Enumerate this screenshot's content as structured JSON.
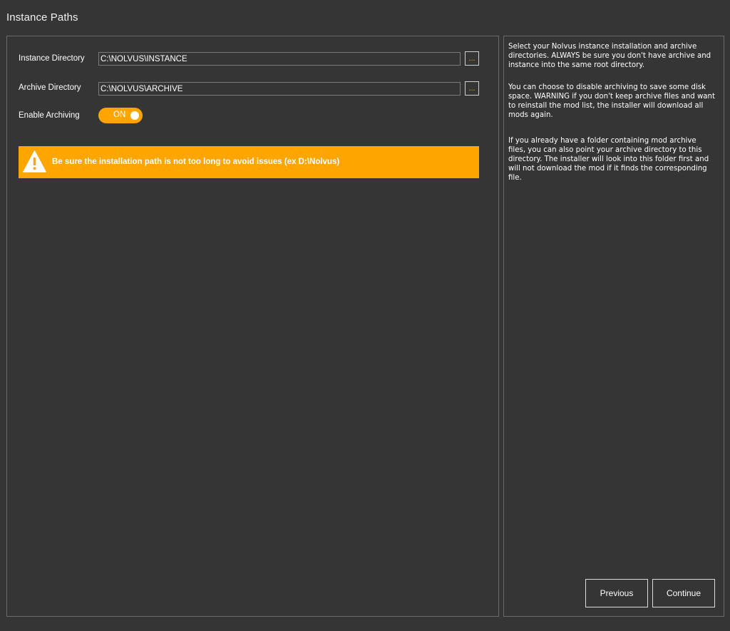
{
  "page": {
    "title": "Instance Paths"
  },
  "form": {
    "instance_label": "Instance Directory",
    "instance_value": "C:\\NOLVUS\\INSTANCE",
    "archive_label": "Archive Directory",
    "archive_value": "C:\\NOLVUS\\ARCHIVE",
    "browse_label": "...",
    "archiving_label": "Enable Archiving",
    "archiving_state": "ON"
  },
  "warning": {
    "icon": "warning-triangle-icon",
    "text": "Be sure the installation path is not too long to avoid issues (ex D:\\Nolvus)"
  },
  "help": {
    "paragraph1": "Select your Nolvus instance installation and archive directories. ALWAYS be sure you don't have archive and instance into the same root directory.",
    "paragraph2": "You can choose to disable archiving to save some disk space. WARNING if you don't keep archive files and want to reinstall the mod list, the installer will download all mods again.",
    "paragraph3": "If you already have a folder containing mod archive files, you can also point your archive directory to this directory. The installer will look into this folder first and will not download the mod if it finds the corresponding file."
  },
  "nav": {
    "previous_label": "Previous",
    "continue_label": "Continue"
  },
  "colors": {
    "background": "#353535",
    "accent": "#ffa500",
    "border": "#6a6a6a"
  }
}
